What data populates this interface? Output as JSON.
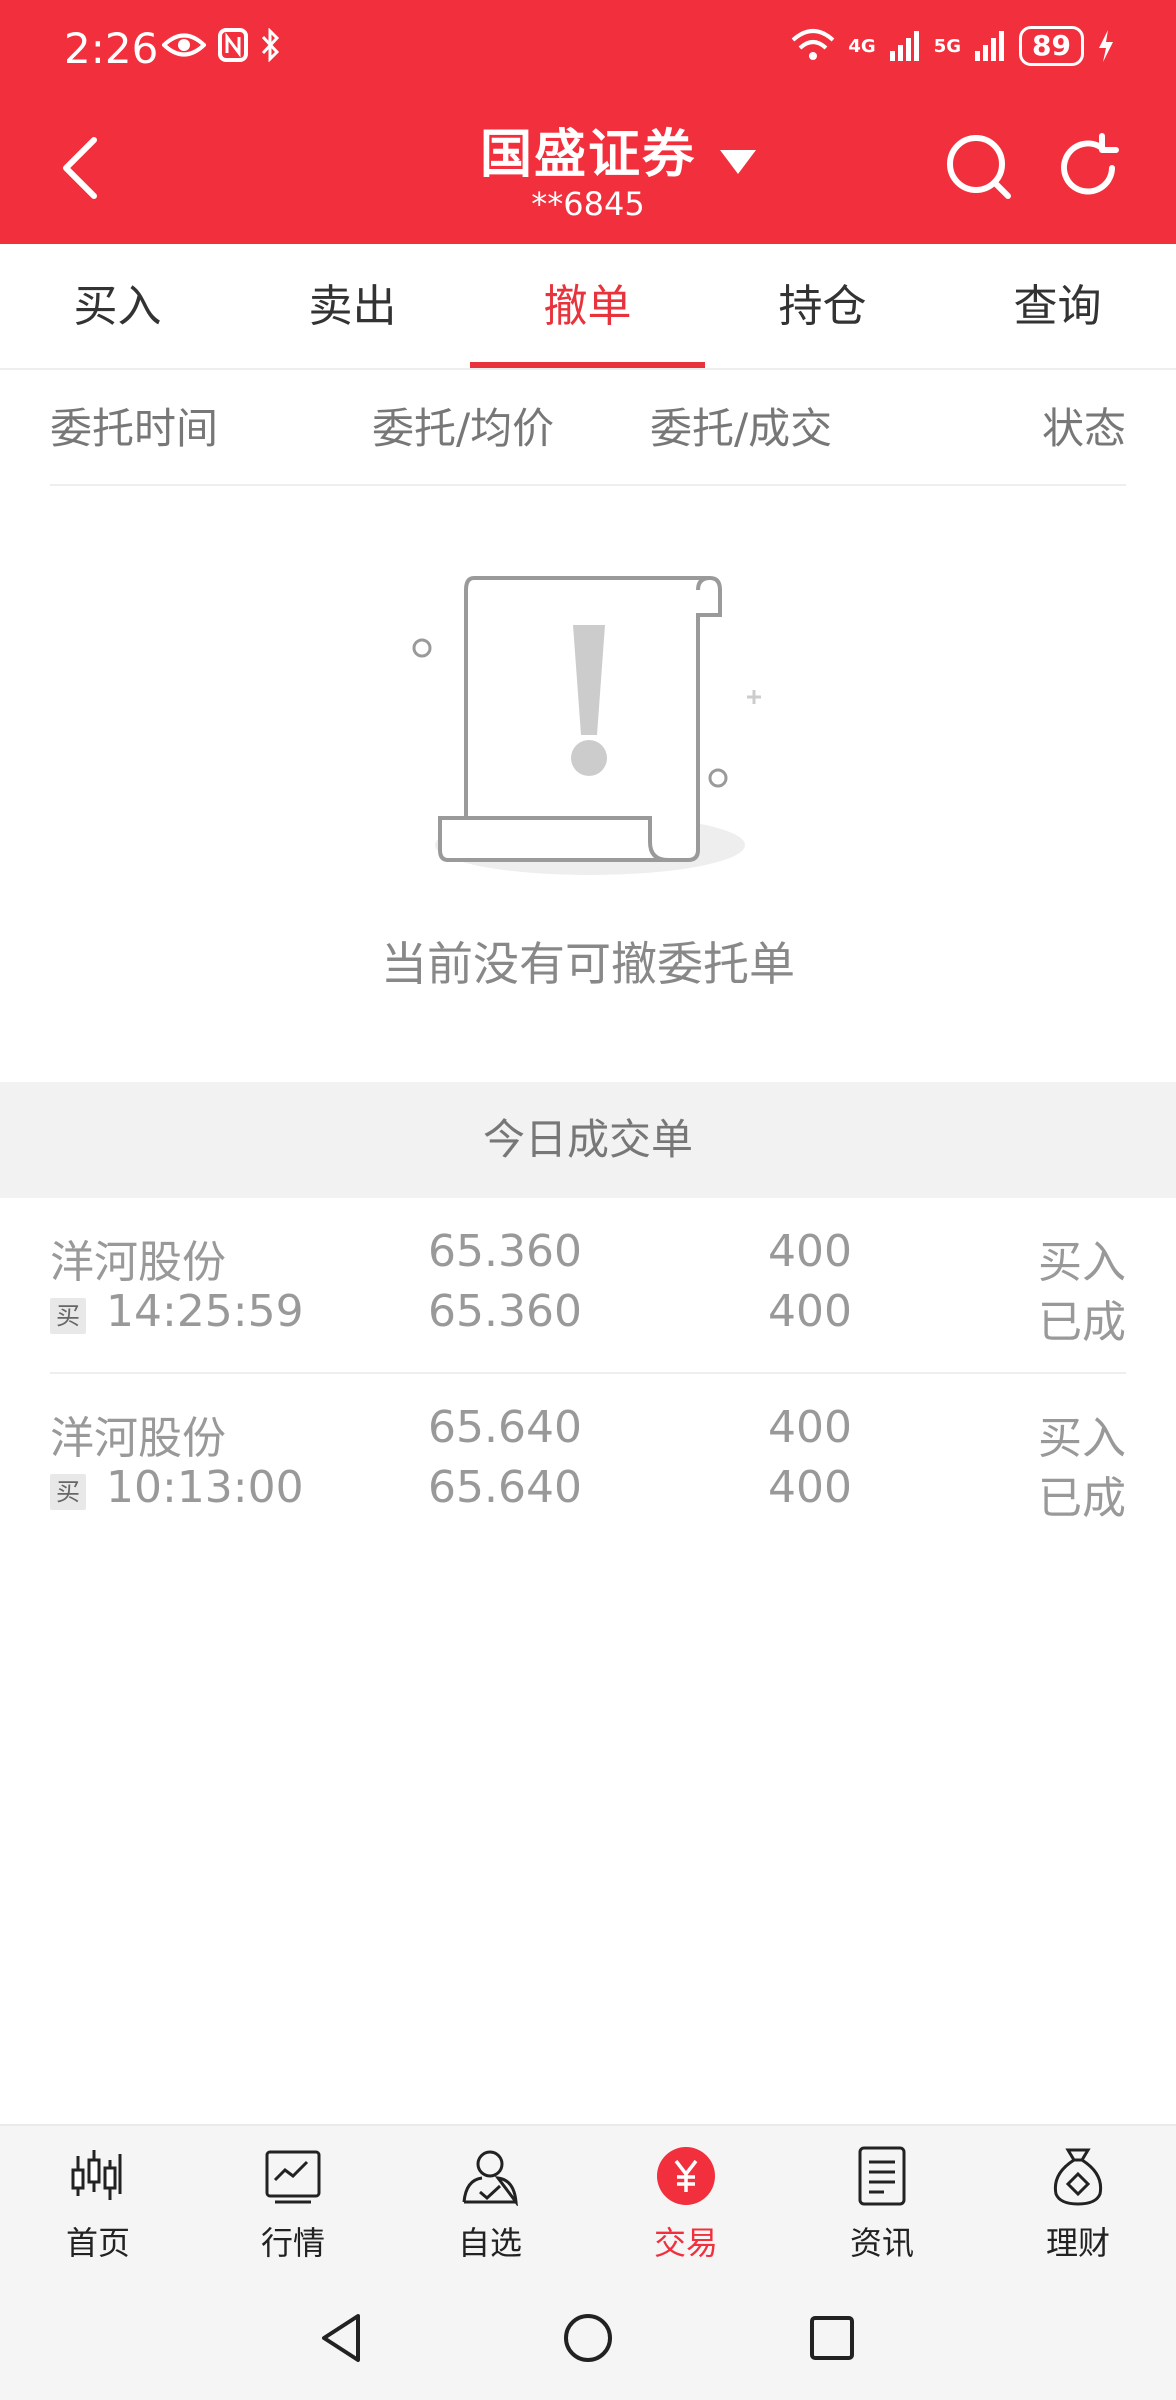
{
  "status": {
    "time": "2:26",
    "battery": "89",
    "net1": "4G",
    "net2": "5G"
  },
  "header": {
    "title": "国盛证券",
    "account": "**6845"
  },
  "tabs": [
    {
      "label": "买入"
    },
    {
      "label": "卖出"
    },
    {
      "label": "撤单",
      "active": true
    },
    {
      "label": "持仓"
    },
    {
      "label": "查询"
    }
  ],
  "columns": [
    "委托时间",
    "委托/均价",
    "委托/成交",
    "状态"
  ],
  "empty": {
    "message": "当前没有可撤委托单"
  },
  "today_section": {
    "title": "今日成交单"
  },
  "trades": [
    {
      "name": "洋河股份",
      "side_badge": "买",
      "time": "14:25:59",
      "order_price": "65.360",
      "avg_price": "65.360",
      "order_qty": "400",
      "filled_qty": "400",
      "direction": "买入",
      "state": "已成"
    },
    {
      "name": "洋河股份",
      "side_badge": "买",
      "time": "10:13:00",
      "order_price": "65.640",
      "avg_price": "65.640",
      "order_qty": "400",
      "filled_qty": "400",
      "direction": "买入",
      "state": "已成"
    }
  ],
  "bottom_nav": [
    {
      "label": "首页",
      "icon": "candlestick-icon"
    },
    {
      "label": "行情",
      "icon": "chart-line-icon"
    },
    {
      "label": "自选",
      "icon": "user-check-icon"
    },
    {
      "label": "交易",
      "icon": "yuan-icon",
      "active": true
    },
    {
      "label": "资讯",
      "icon": "document-icon"
    },
    {
      "label": "理财",
      "icon": "money-bag-icon"
    }
  ],
  "colors": {
    "brand": "#f22f3c",
    "accent_text": "#e8323c",
    "muted_text": "#999999"
  }
}
